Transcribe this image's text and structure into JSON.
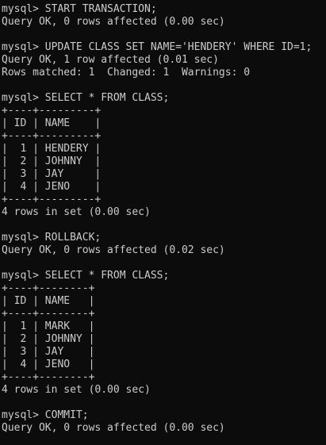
{
  "terminal": {
    "lines": [
      "mysql> START TRANSACTION;",
      "Query OK, 0 rows affected (0.00 sec)",
      "",
      "mysql> UPDATE CLASS SET NAME='HENDERY' WHERE ID=1;",
      "Query OK, 1 row affected (0.01 sec)",
      "Rows matched: 1  Changed: 1  Warnings: 0",
      "",
      "mysql> SELECT * FROM CLASS;",
      "+----+---------+",
      "| ID | NAME    |",
      "+----+---------+",
      "|  1 | HENDERY |",
      "|  2 | JOHNNY  |",
      "|  3 | JAY     |",
      "|  4 | JENO    |",
      "+----+---------+",
      "4 rows in set (0.00 sec)",
      "",
      "mysql> ROLLBACK;",
      "Query OK, 0 rows affected (0.02 sec)",
      "",
      "mysql> SELECT * FROM CLASS;",
      "+----+--------+",
      "| ID | NAME   |",
      "+----+--------+",
      "|  1 | MARK   |",
      "|  2 | JOHNNY |",
      "|  3 | JAY    |",
      "|  4 | JENO   |",
      "+----+--------+",
      "4 rows in set (0.00 sec)",
      "",
      "mysql> COMMIT;",
      "Query OK, 0 rows affected (0.00 sec)"
    ]
  }
}
